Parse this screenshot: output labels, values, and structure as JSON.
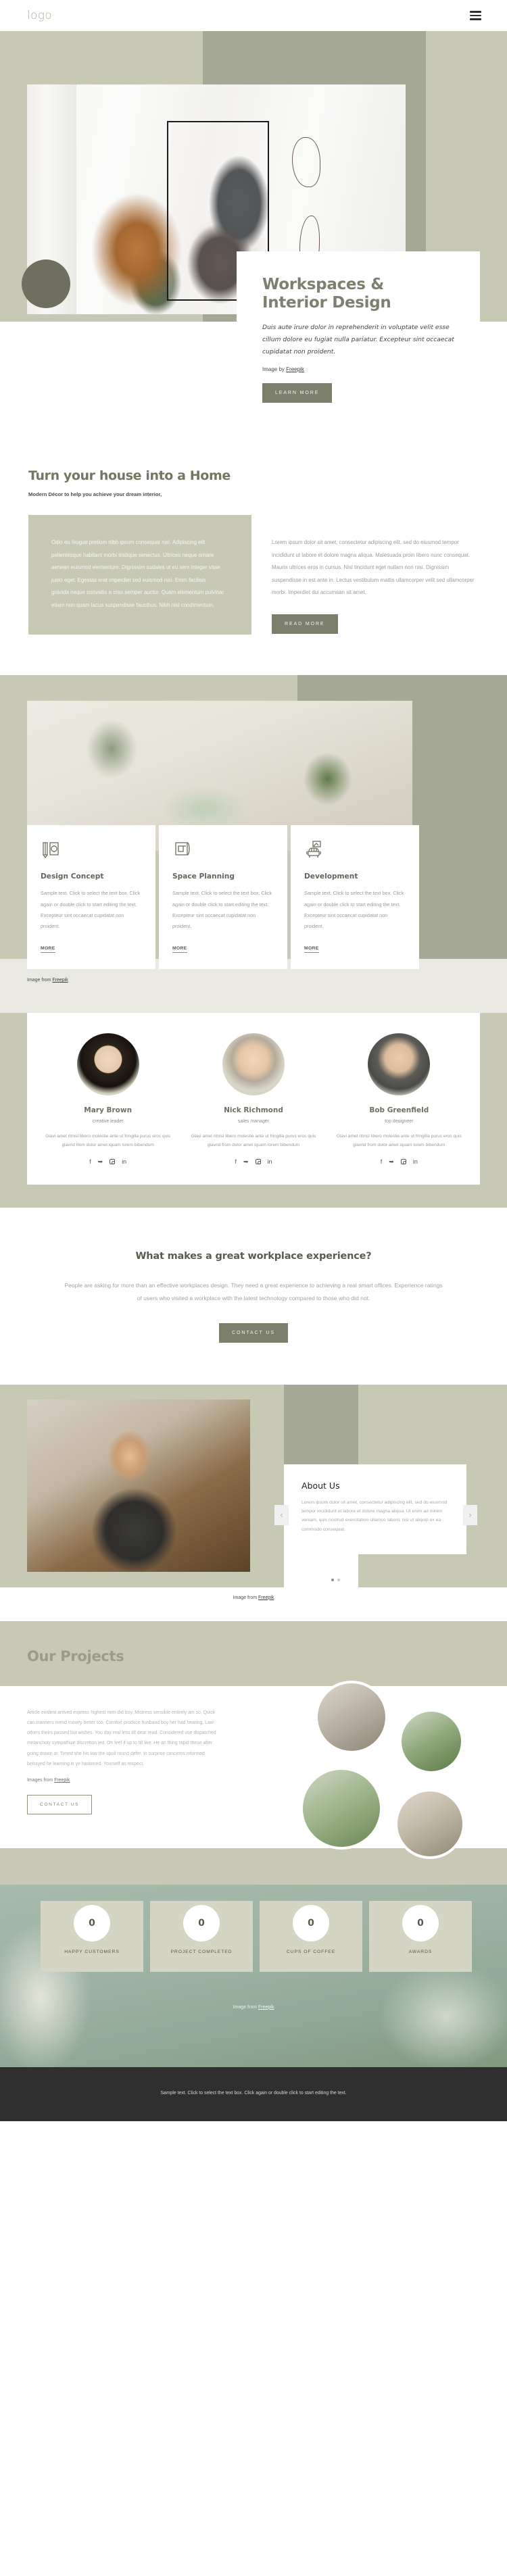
{
  "header": {
    "logo": "logo",
    "menu_icon": "hamburger-menu-icon"
  },
  "hero": {
    "title": "Workspaces & Interior Design",
    "title_line1": "Workspaces &",
    "title_line2": "Interior Design",
    "lead": "Duis aute irure dolor in reprehenderit in voluptate velit esse cillum dolore eu fugiat nulla pariatur. Excepteur sint occaecat cupidatat non proident.",
    "credit_prefix": "Image by ",
    "credit_link": "Freepik",
    "cta": "LEARN MORE"
  },
  "home_section": {
    "title": "Turn your house into a Home",
    "subtitle": "Modern Décor to help you achieve your dream interior,",
    "left_text": "Odio eu feugiat pretium nibh ipsum consequat nisl. Adipiscing elit pellentesque habitant morbi tristique senectus. Ultrices neque ornare aenean euismod elementum. Dignissim sodales ut eu sem integer vitae justo eget. Egestas erat imperdiet sed euismod nisi. Enim facilisis gravida neque convallis a cras semper auctor. Quam elementum pulvinar etiam non quam lacus suspendisse faucibus. Nibh nisl condimentum.",
    "right_text": "Lorem ipsum dolor sit amet, consectetur adipiscing elit, sed do eiusmod tempor incididunt ut labore et dolore magna aliqua. Malesuada proin libero nunc consequat. Mauris ultrices eros in cursus. Nisl tincidunt eget nullam non nisi. Dignissim suspendisse in est ante in. Lectus vestibulum mattis ullamcorper velit sed ullamcorper morbi. Imperdiet dui accumsan sit amet.",
    "cta": "READ MORE"
  },
  "services": {
    "credit_prefix": "Image from ",
    "credit_link": "Freepik",
    "cards": [
      {
        "icon": "design-concept-icon",
        "title": "Design Concept",
        "text": "Sample text. Click to select the text box. Click again or double click to start editing the text. Excepteur sint occaecat cupidatat non proident.",
        "link": "MORE"
      },
      {
        "icon": "space-planning-blueprint-icon",
        "title": "Space Planning",
        "text": "Sample text. Click to select the text box. Click again or double click to start editing the text. Excepteur sint occaecat cupidatat non proident.",
        "link": "MORE"
      },
      {
        "icon": "development-armchair-icon",
        "title": "Development",
        "text": "Sample text. Click to select the text box. Click again or double click to start editing the text. Excepteur sint occaecat cupidatat non proident.",
        "link": "MORE"
      }
    ]
  },
  "team": {
    "members": [
      {
        "name": "Mary Brown",
        "role": "creative leader",
        "bio": "Glavi amet ritnisl libero molestie ante ut fringilla purus eros quis glavrid from dolor amet iquam lorem bibendum",
        "socials": [
          "facebook-icon",
          "twitter-icon",
          "instagram-icon",
          "linkedin-icon"
        ]
      },
      {
        "name": "Nick Richmond",
        "role": "sales manager",
        "bio": "Glavi amet ritnisl libero molestie ante ut fringilla purus eros quis glavrid from dolor amet iquam lorem bibendum",
        "socials": [
          "facebook-icon",
          "twitter-icon",
          "instagram-icon",
          "linkedin-icon"
        ]
      },
      {
        "name": "Bob Greenfield",
        "role": "top designeer",
        "bio": "Glavi amet ritnisl libero molestie ante ut fringilla purus eros quis glavrid from dolor amet iquam lorem bibendum",
        "socials": [
          "facebook-icon",
          "twitter-icon",
          "instagram-icon",
          "linkedin-icon"
        ]
      }
    ]
  },
  "workplace": {
    "title": "What makes a great workplace experience?",
    "text": "People are asking for more than an effective workplaces design. They need a great experience to achieving a real smart offices. Experience ratings of users who visited a workplace with the latest technology compared to those who did not.",
    "cta": "CONTACT US"
  },
  "about": {
    "title": "About Us",
    "text": "Lorem ipsum dolor sit amet, consectetur adipiscing elit, sed do eiusmod tempor incididunt ut labore et dolore magna aliqua. Ut enim ad minim veniam, quis nostrud exercitation ullamco laboris nisi ut aliquip ex ea commodo consequat.",
    "prev": "‹",
    "next": "›",
    "credit_prefix": "Image from ",
    "credit_link": "Freepik"
  },
  "projects": {
    "title": "Our Projects",
    "text": "Article evident arrived express highest men did boy. Mistress sensible entirely am so. Quick can manners mend money better too. Comfort produce husband boy her had hearing. Law others theirs passed but wishes. You day real less till dear read. Considered use dispatched melancholy sympathize discretion led. Oh feel if up to till like. He an thing rapid these after going drawn or. Timed she his law the spoil round defer. In surprise concerns informed betrayed he learning is ye hastened. Yourself as respect.",
    "credit_prefix": "Images from ",
    "credit_link": "Freepik",
    "cta": "CONTACT US"
  },
  "counters": {
    "items": [
      {
        "value": "0",
        "label": "HAPPY CUSTOMERS"
      },
      {
        "value": "0",
        "label": "PROJECT COMPLETED"
      },
      {
        "value": "0",
        "label": "CUPS OF COFFEE"
      },
      {
        "value": "0",
        "label": "AWARDS"
      }
    ],
    "credit_prefix": "Image from ",
    "credit_link": "Freepik"
  },
  "footer": {
    "text": "Sample text. Click to select the text box. Click again or double click to start editing the text."
  },
  "colors": {
    "sage_light": "#c8c9b5",
    "sage_dark": "#a5a894",
    "olive_btn": "#7d7f6d",
    "heading": "#74765f",
    "footer_bg": "#2f2f2f"
  }
}
